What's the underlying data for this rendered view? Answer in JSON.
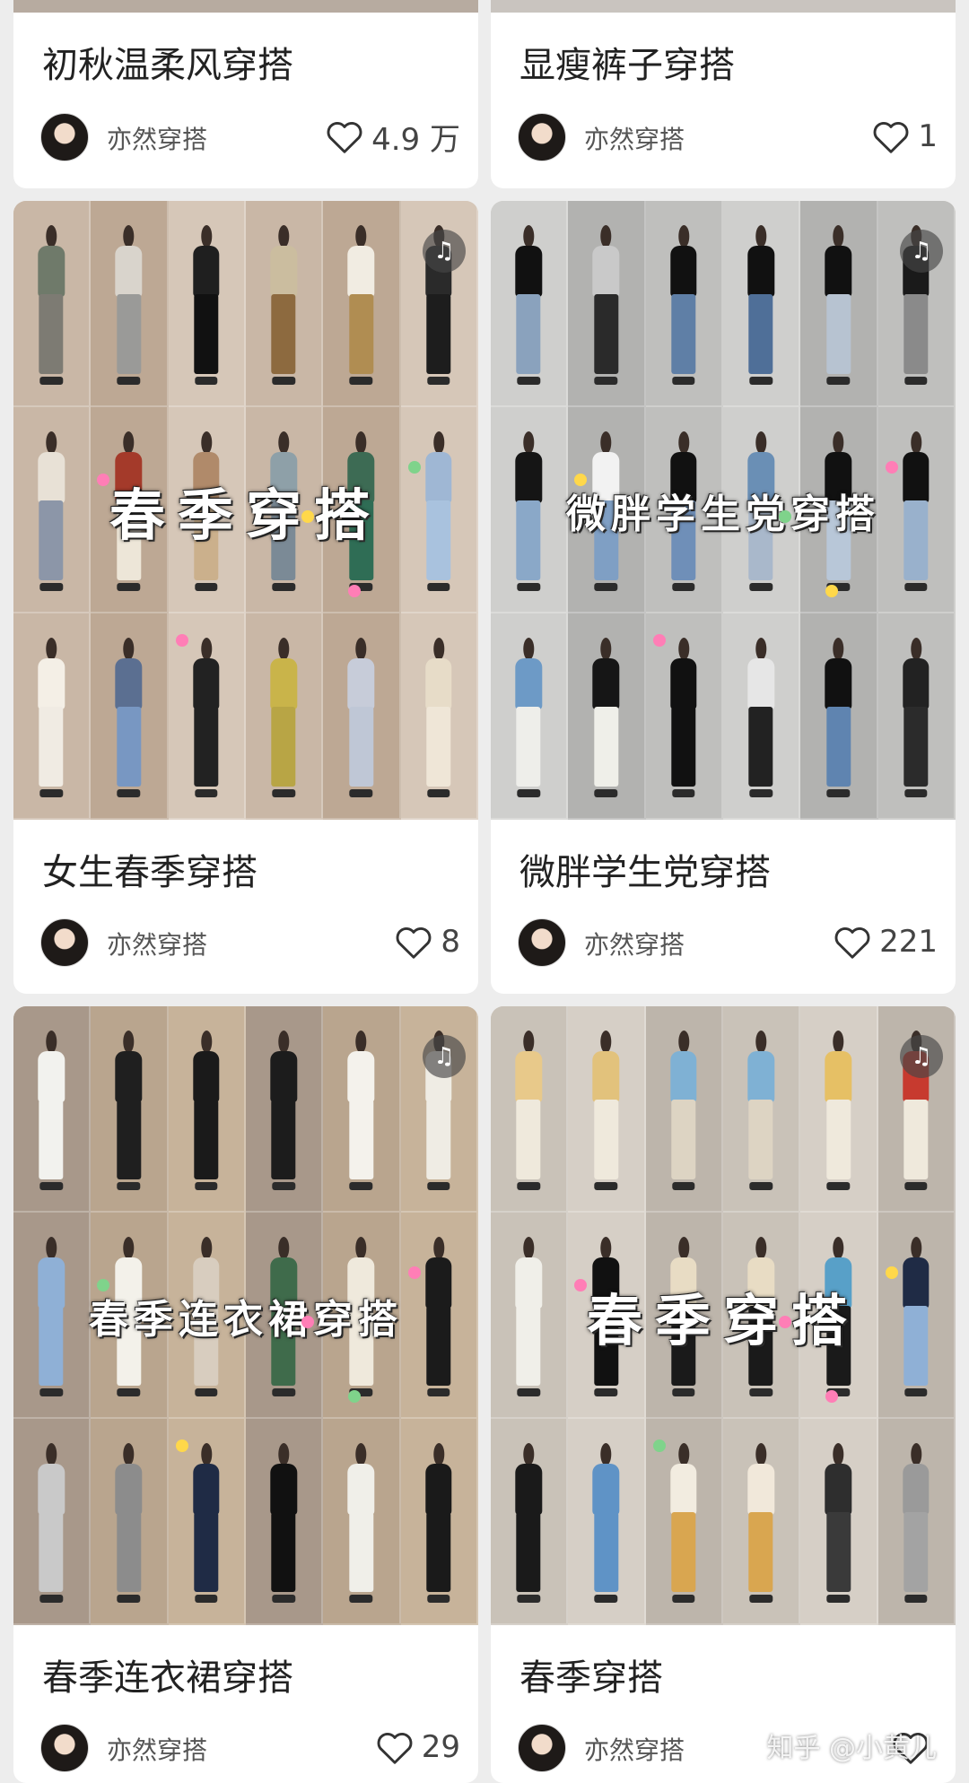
{
  "cards": [
    {
      "title": "初秋温柔风穿搭",
      "author": "亦然穿搭",
      "likes": "4.9 万",
      "overlay": ""
    },
    {
      "title": "显瘦裤子穿搭",
      "author": "亦然穿搭",
      "likes": "1",
      "overlay": ""
    },
    {
      "title": "女生春季穿搭",
      "author": "亦然穿搭",
      "likes": "8",
      "overlay": "春季穿搭"
    },
    {
      "title": "微胖学生党穿搭",
      "author": "亦然穿搭",
      "likes": "221",
      "overlay": "微胖学生党穿搭"
    },
    {
      "title": "春季连衣裙穿搭",
      "author": "亦然穿搭",
      "likes": "29",
      "overlay": "春季连衣裙穿搭"
    },
    {
      "title": "春季穿搭",
      "author": "亦然穿搭",
      "likes": "",
      "overlay": "春季穿搭"
    }
  ],
  "icons": {
    "heart": "heart-outline-icon",
    "music": "music-note-icon",
    "avatar": "author-avatar"
  },
  "watermark": "知乎 @小黄儿",
  "colors": {
    "page_bg": "#ededed",
    "card_bg": "#ffffff",
    "title_text": "#222222",
    "meta_text": "#555555"
  }
}
